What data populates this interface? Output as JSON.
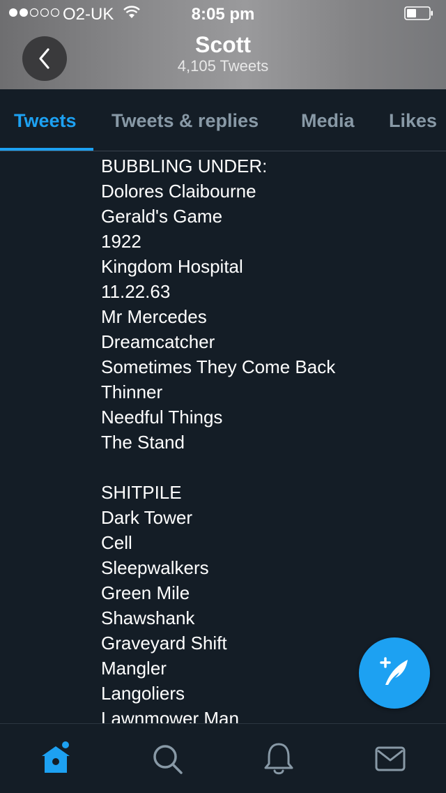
{
  "status_bar": {
    "carrier": "O2-UK",
    "time": "8:05 pm",
    "signal_bars_filled": 2,
    "signal_bars_total": 5
  },
  "header": {
    "title": "Scott",
    "subtitle": "4,105 Tweets",
    "back_icon": "chevron-left-icon"
  },
  "tabs": [
    {
      "label": "Tweets",
      "active": true
    },
    {
      "label": "Tweets & replies",
      "active": false
    },
    {
      "label": "Media",
      "active": false
    },
    {
      "label": "Likes",
      "active": false
    }
  ],
  "tweet_lines": [
    "BUBBLING UNDER:",
    "Dolores Claibourne",
    "Gerald's Game",
    "1922",
    "Kingdom Hospital",
    "11.22.63",
    "Mr Mercedes",
    "Dreamcatcher",
    "Sometimes They Come Back",
    "Thinner",
    "Needful Things",
    "The Stand",
    "",
    "SHITPILE",
    "Dark Tower",
    "Cell",
    "Sleepwalkers",
    "Green Mile",
    "Shawshank",
    "Graveyard Shift",
    "Mangler",
    "Langoliers",
    "Lawnmower Man"
  ],
  "compose_icon": "compose-tweet-icon",
  "bottom_nav": [
    {
      "icon": "home-icon",
      "active": true
    },
    {
      "icon": "search-icon",
      "active": false
    },
    {
      "icon": "notifications-bell-icon",
      "active": false
    },
    {
      "icon": "messages-envelope-icon",
      "active": false
    }
  ],
  "colors": {
    "background": "#141d26",
    "accent": "#1da1f2",
    "inactive": "#8899a6"
  }
}
